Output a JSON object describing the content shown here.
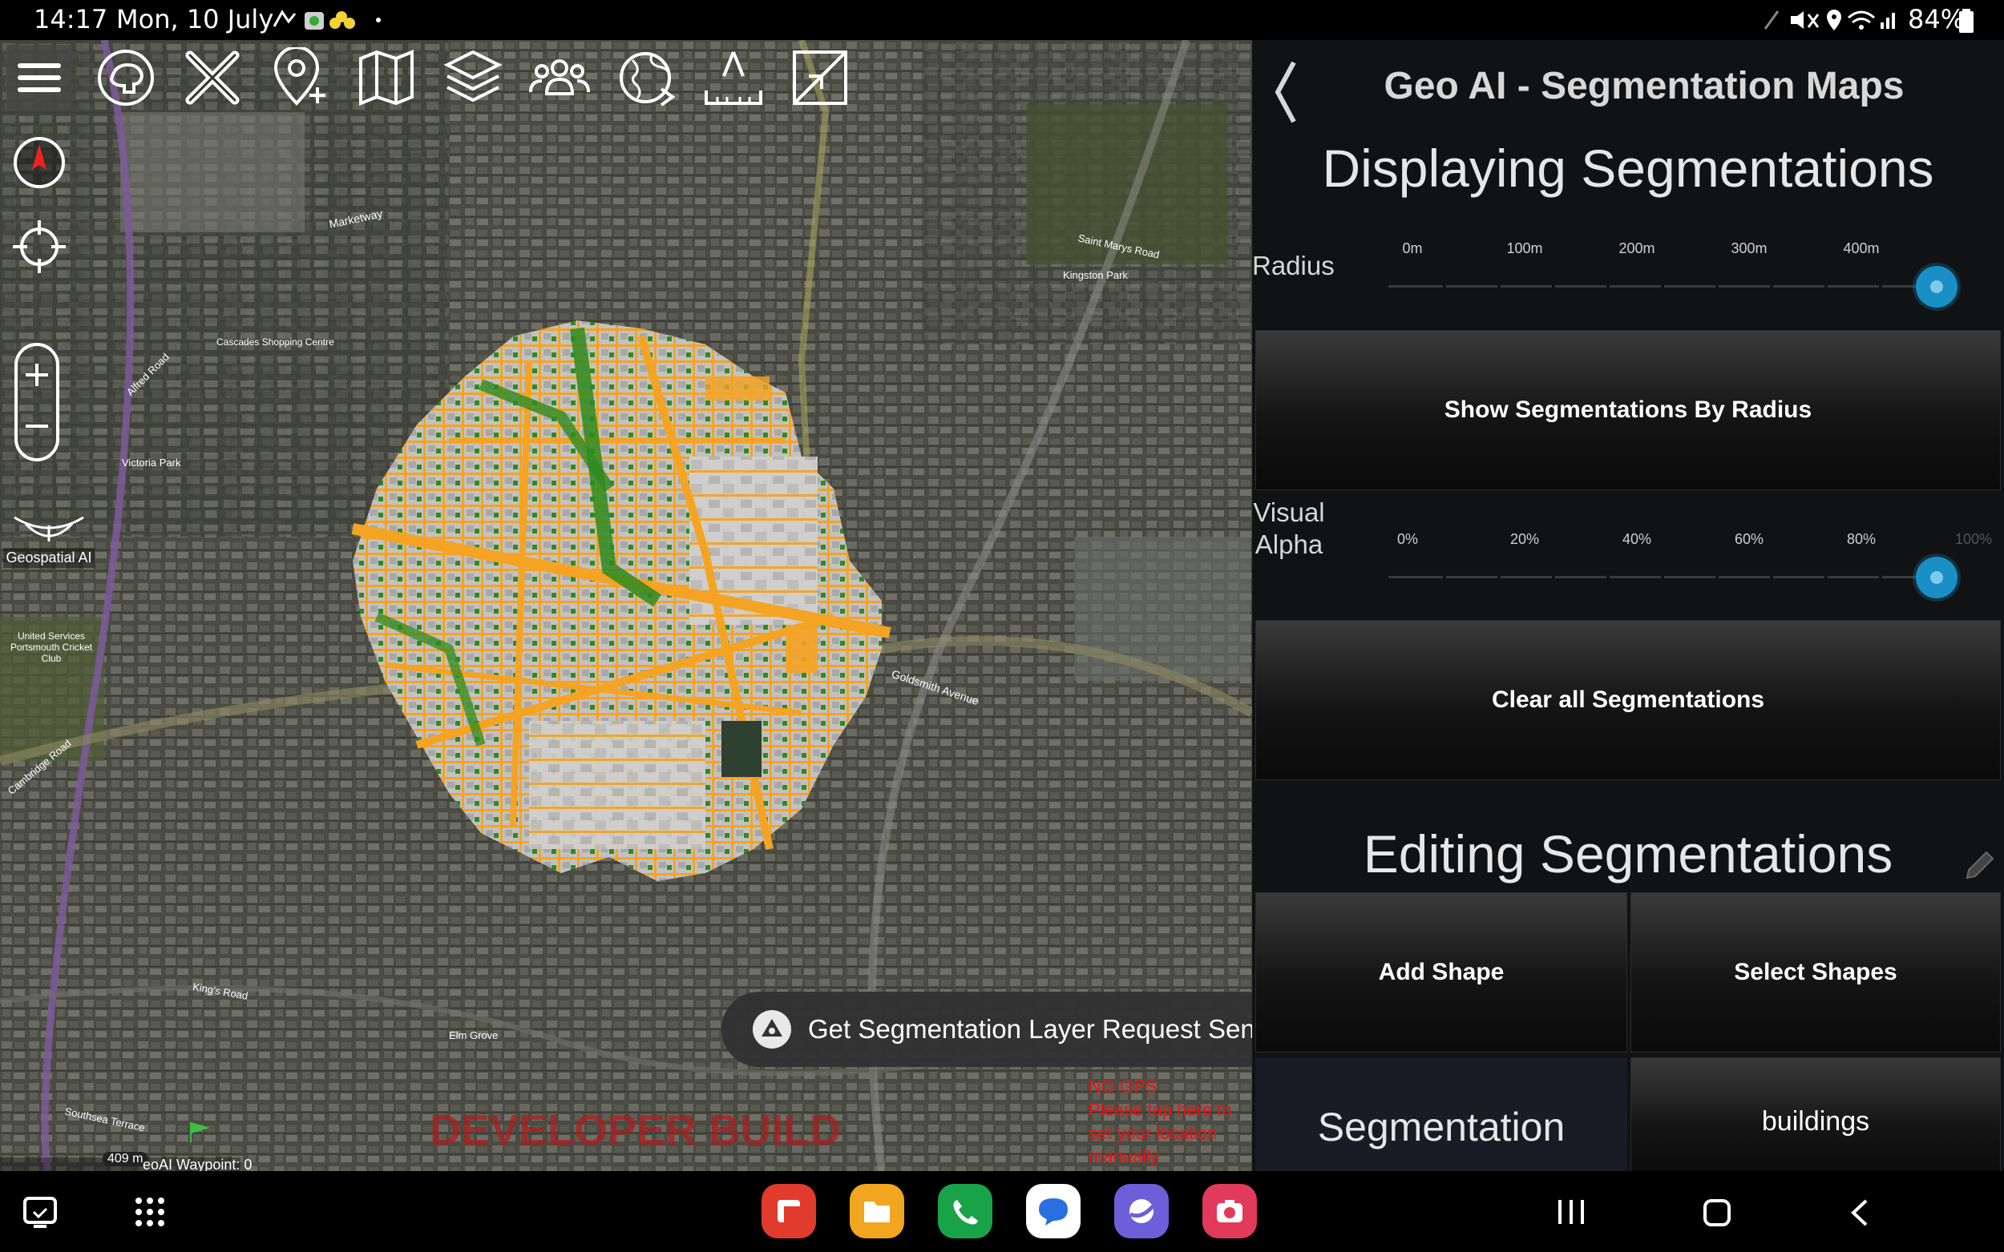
{
  "status": {
    "time": "14:17",
    "date": "Mon, 10 July",
    "battery": "84%"
  },
  "map": {
    "toolbar_icons": [
      "menu-icon",
      "brain-icon",
      "close-x-icon",
      "add-place-icon",
      "map-icon",
      "layers-icon",
      "group-icon",
      "globe-icon",
      "ruler-icon",
      "resize-icon"
    ],
    "logo_label": "Geospatial AI",
    "scale_label": "409 m",
    "waypoint_label": "eoAI Waypoint: 0",
    "watermark": "DEVELOPER BUILD",
    "no_gps_lines": [
      "NO GPS",
      "Please tap here to",
      "set your location",
      "manually"
    ],
    "toast": "Get Segmentation Layer Request Sent",
    "places": [
      {
        "text": "Marketway"
      },
      {
        "text": "Kingston Park"
      },
      {
        "text": "United Services Portsmouth Cricket Club"
      },
      {
        "text": "Goldsmith Avenue"
      },
      {
        "text": "Victoria Park"
      },
      {
        "text": "Southsea Terrace"
      },
      {
        "text": "Saint Marys Road"
      },
      {
        "text": "Alfred Road"
      },
      {
        "text": "King's Road"
      },
      {
        "text": "Elm Grove"
      },
      {
        "text": "Cambridge Road"
      },
      {
        "text": "Cascades Shopping Centre"
      }
    ],
    "colors": {
      "roads": "#f5a323",
      "vegetation": "#2e8b1e",
      "buildings": "#bdbdbd"
    }
  },
  "panel": {
    "header_title": "Geo AI - Segmentation Maps",
    "section1_title": "Displaying Segmentations",
    "radius_label": "Radius",
    "radius_ticks": [
      "0m",
      "100m",
      "200m",
      "300m",
      "400m"
    ],
    "radius_value": 1.0,
    "show_button": "Show Segmentations By Radius",
    "alpha_label_1": "Visual",
    "alpha_label_2": "Alpha",
    "alpha_ticks": [
      "0%",
      "20%",
      "40%",
      "60%",
      "80%",
      "100%"
    ],
    "alpha_value": 1.0,
    "clear_button": "Clear all Segmentations",
    "section2_title": "Editing Segmentations",
    "add_shape_button": "Add Shape",
    "select_shapes_button": "Select Shapes",
    "segmentation_label": "Segmentation",
    "class_select": "buildings"
  },
  "navbar": {
    "apps": [
      "flipboard-app-icon",
      "files-app-icon",
      "phone-app-icon",
      "messages-app-icon",
      "browser-app-icon",
      "camera-app-icon"
    ]
  }
}
